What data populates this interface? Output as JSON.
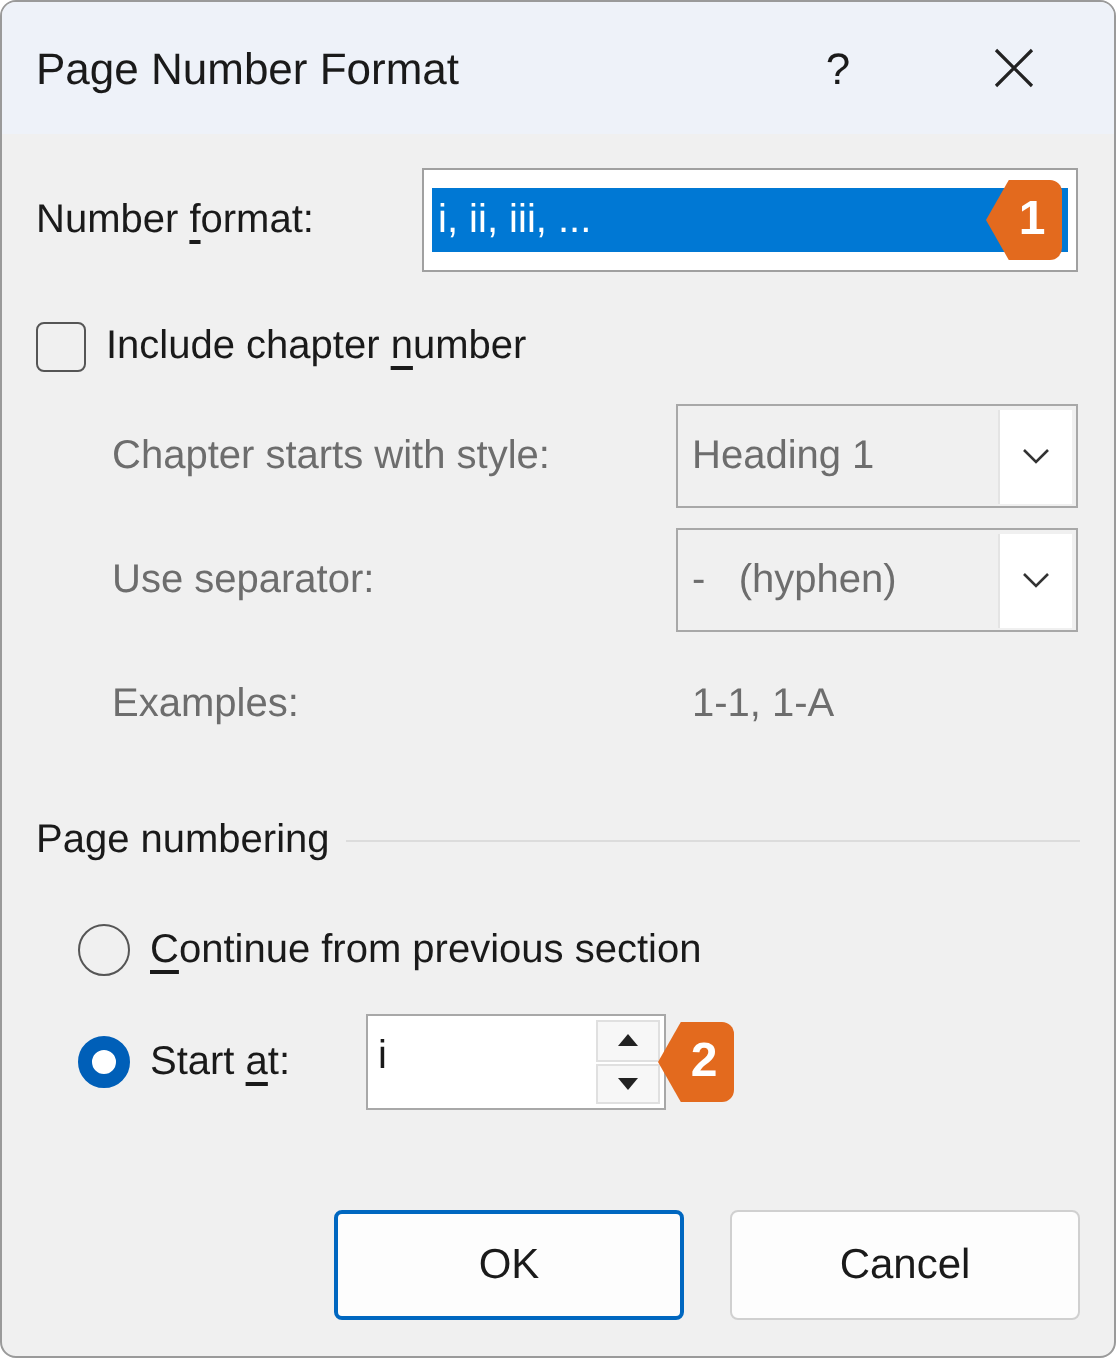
{
  "window": {
    "title": "Page Number Format",
    "help": "?"
  },
  "number_format": {
    "label_before": "Number ",
    "access_key": "f",
    "label_after": "ormat:",
    "value": "i, ii, iii, ...",
    "selected": true,
    "callout": "1"
  },
  "include_chapter": {
    "label_before": "Include chapter ",
    "access_key": "n",
    "label_after": "umber",
    "checked": false
  },
  "chapter_options": [
    {
      "kind": "combo",
      "label": "Chapter starts with style:",
      "value": "Heading 1",
      "disabled": true
    },
    {
      "kind": "combo",
      "label": "Use separator:",
      "value": "-   (hyphen)",
      "disabled": true
    },
    {
      "kind": "text",
      "label": "Examples:",
      "value": "1-1, 1-A",
      "disabled": true
    }
  ],
  "page_numbering": {
    "title": "Page numbering",
    "options": [
      {
        "kind": "radio",
        "access_key": "C",
        "label_after": "ontinue from previous section",
        "selected": false
      },
      {
        "kind": "start",
        "label_before": "Start ",
        "access_key": "a",
        "label_after": "t:",
        "selected": true,
        "value": "i",
        "callout": "2"
      }
    ]
  },
  "buttons": [
    {
      "label": "OK",
      "default": true
    },
    {
      "label": "Cancel",
      "default": false
    }
  ]
}
